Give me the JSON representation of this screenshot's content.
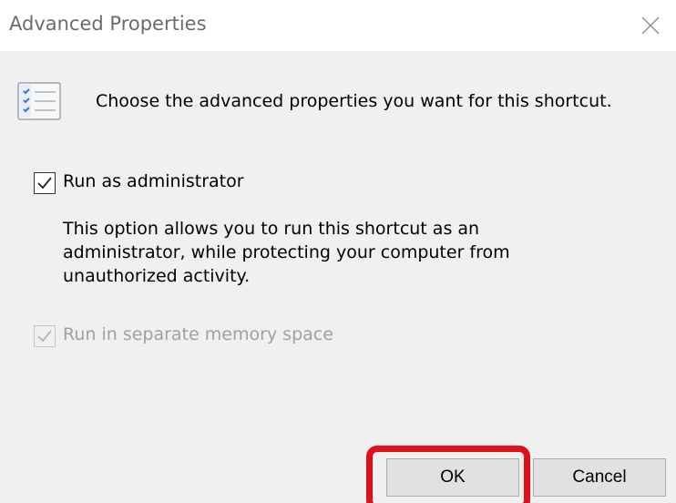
{
  "window": {
    "title": "Advanced Properties",
    "close_icon": "close-icon"
  },
  "intro": {
    "icon": "properties-list-icon",
    "text": "Choose the advanced properties you want for this shortcut."
  },
  "run_as_admin": {
    "label": "Run as administrator",
    "checked": true,
    "description_lines": [
      "This option allows you to run this shortcut as an",
      "administrator, while protecting your computer from",
      "unauthorized activity."
    ]
  },
  "separate_memory": {
    "label": "Run in separate memory space",
    "checked": true,
    "disabled": true
  },
  "buttons": {
    "ok_label": "OK",
    "cancel_label": "Cancel"
  },
  "highlight": {
    "target": "ok-button",
    "color": "#e0101a"
  }
}
